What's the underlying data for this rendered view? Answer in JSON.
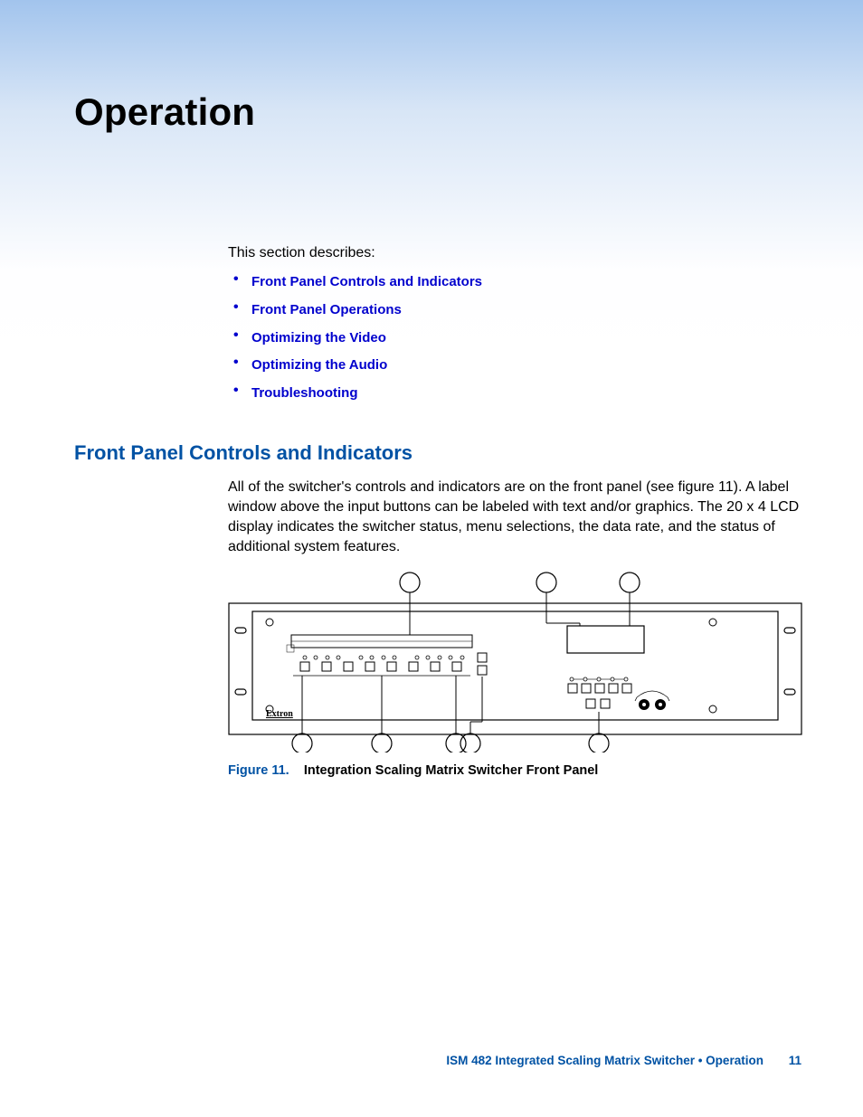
{
  "title": "Operation",
  "intro": "This section describes:",
  "links": [
    "Front Panel Controls and Indicators",
    "Front Panel Operations",
    "Optimizing the Video",
    "Optimizing the Audio",
    "Troubleshooting"
  ],
  "subsection_heading": "Front Panel Controls and Indicators",
  "subsection_body": "All of the switcher's controls and indicators are on the front panel (see figure 11).  A label window above the input buttons can be labeled with text and/or graphics.  The 20 x 4 LCD display indicates the switcher status, menu selections, the data rate, and the status of additional system features.",
  "figure": {
    "number": "Figure 11.",
    "title": "Integration Scaling Matrix Switcher Front Panel",
    "brand_label": "Extron"
  },
  "footer": {
    "text": "ISM 482 Integrated Scaling Matrix Switcher • Operation",
    "page": "11"
  }
}
